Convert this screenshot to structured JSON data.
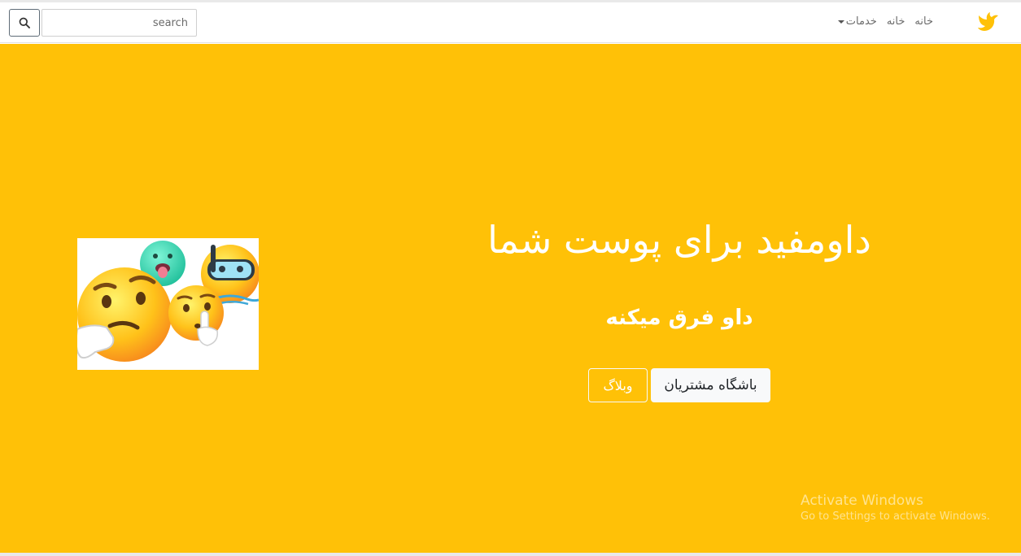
{
  "navbar": {
    "logo_icon": "bird-logo-icon",
    "links": [
      {
        "label": "خانه"
      },
      {
        "label": "خانه"
      },
      {
        "label": "خدمات"
      }
    ],
    "search": {
      "placeholder": "search",
      "button_icon": "search-icon"
    }
  },
  "hero": {
    "background": "#ffc107",
    "title": "داومفید برای پوست شما",
    "subtitle": "داو فرق میکنه",
    "buttons": {
      "primary_label": "باشگاه مشتریان",
      "secondary_label": "وبلاگ"
    },
    "image_icon": "emoji-faces-image"
  },
  "watermark": {
    "title": "Activate Windows",
    "subtitle": "Go to Settings to activate Windows."
  }
}
